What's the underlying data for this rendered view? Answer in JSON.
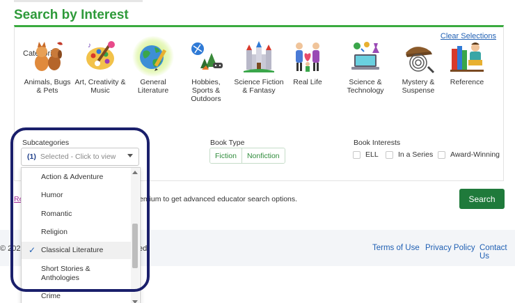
{
  "page": {
    "title": "Search by Interest",
    "clear_selections": "Clear Selections"
  },
  "categories": {
    "label": "Categories",
    "items": [
      {
        "line1": "Animals, Bugs",
        "line2": "& Pets",
        "line3": "",
        "icon": "animals-icon",
        "selected": false
      },
      {
        "line1": "Art, Creativity &",
        "line2": "Music",
        "line3": "",
        "icon": "art-palette-icon",
        "selected": false
      },
      {
        "line1": "General",
        "line2": "Literature",
        "line3": "",
        "icon": "globe-icon",
        "selected": true
      },
      {
        "line1": "Hobbies,",
        "line2": "Sports &",
        "line3": "Outdoors",
        "icon": "hobbies-icon",
        "selected": false
      },
      {
        "line1": "Science Fiction",
        "line2": "& Fantasy",
        "line3": "",
        "icon": "castle-icon",
        "selected": false
      },
      {
        "line1": "Real Life",
        "line2": "",
        "line3": "",
        "icon": "family-icon",
        "selected": false
      },
      {
        "line1": "Science &",
        "line2": "Technology",
        "line3": "",
        "icon": "laptop-science-icon",
        "selected": false
      },
      {
        "line1": "Mystery &",
        "line2": "Suspense",
        "line3": "",
        "icon": "fingerprint-icon",
        "selected": false
      },
      {
        "line1": "Reference",
        "line2": "",
        "line3": "",
        "icon": "books-reader-icon",
        "selected": false
      }
    ]
  },
  "subcategories": {
    "label": "Subcategories",
    "count": "(1)",
    "placeholder": "Selected - Click to view",
    "options": [
      {
        "line1": "Action & Adventure",
        "line2": "",
        "checked": false
      },
      {
        "line1": "Humor",
        "line2": "",
        "checked": false
      },
      {
        "line1": "Romantic",
        "line2": "",
        "checked": false
      },
      {
        "line1": "Religion",
        "line2": "",
        "checked": false
      },
      {
        "line1": "Classical Literature",
        "line2": "",
        "checked": true
      },
      {
        "line1": "Short Stories &",
        "line2": "Anthologies",
        "checked": false
      },
      {
        "line1": "Crime",
        "line2": "",
        "checked": false
      }
    ]
  },
  "book_type": {
    "label": "Book Type",
    "options": [
      "Fiction",
      "Nonfiction"
    ]
  },
  "book_interests": {
    "label": "Book Interests",
    "options": [
      "ELL",
      "In a Series",
      "Award-Winning"
    ]
  },
  "upgrade": {
    "link": "Re",
    "text": "emium to get advanced educator search options."
  },
  "search_button": "Search",
  "footer": {
    "copyright_start": "© 202",
    "copyright_end": "ed",
    "links": [
      "Terms of Use",
      "Privacy Policy",
      "Contact Us"
    ]
  },
  "colors": {
    "accent_green": "#2e9a3a",
    "button_green": "#1f7a3b",
    "highlight_navy": "#1a1f6b",
    "link_blue": "#1f5fb3"
  }
}
